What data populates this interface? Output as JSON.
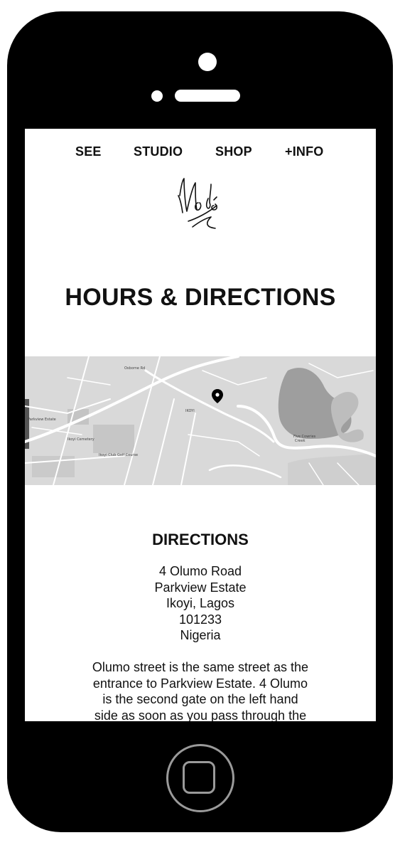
{
  "nav": {
    "items": [
      {
        "label": "SEE"
      },
      {
        "label": "STUDIO"
      },
      {
        "label": "SHOP"
      },
      {
        "label": "+INFO"
      }
    ]
  },
  "logo": {
    "text": "Modé"
  },
  "page": {
    "title": "HOURS & DIRECTIONS"
  },
  "map": {
    "area_label": "IKOYI",
    "place_labels": [
      "Ikoyi Cemetery",
      "Ikoyi Club Golf Course",
      "Five Cowries Creek",
      "Parkview Estate",
      "Osborne Rd"
    ],
    "marker_icon": "map-pin-icon"
  },
  "directions": {
    "heading": "DIRECTIONS",
    "address_lines": [
      "4 Olumo Road",
      "Parkview Estate",
      "Ikoyi, Lagos",
      "101233",
      "Nigeria"
    ],
    "description": "Olumo street is the same street as the entrance to Parkview Estate. 4 Olumo is the second gate on the left hand side as soon as you pass through the"
  },
  "colors": {
    "phone_body": "#000000",
    "screen_bg": "#ffffff",
    "text": "#111111",
    "map_land": "#d9d9d9",
    "map_water": "#9e9e9e",
    "map_road": "#ffffff"
  }
}
